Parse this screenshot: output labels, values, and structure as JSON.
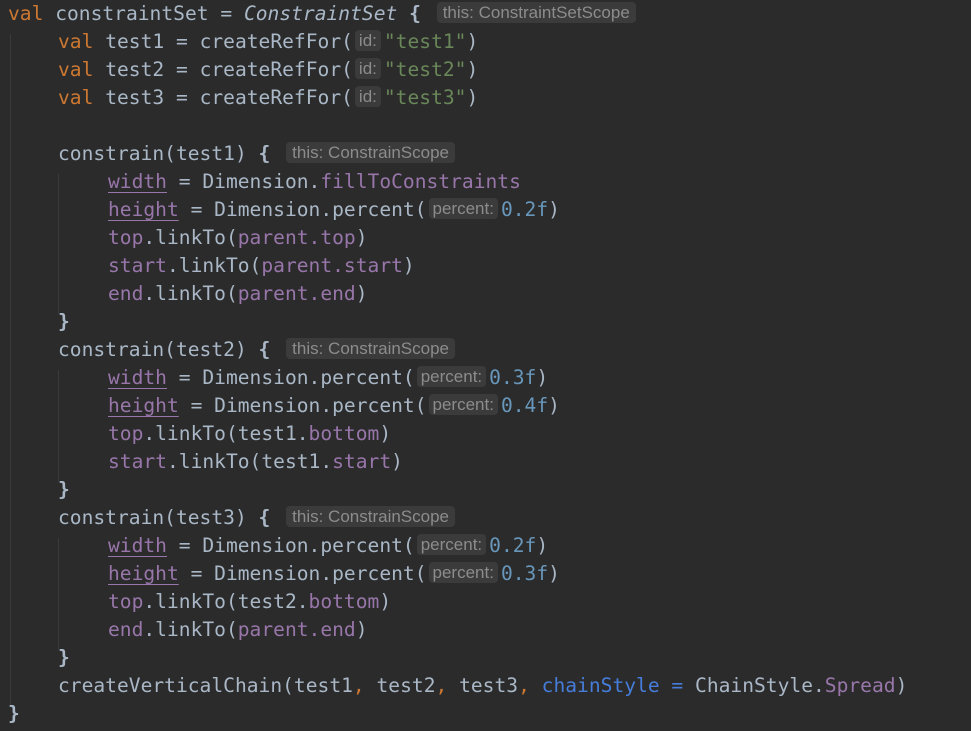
{
  "colors": {
    "background": "#2b2b2b",
    "keyword": "#cc7832",
    "string": "#6a8759",
    "number": "#6897bb",
    "property": "#9876aa",
    "named_arg": "#467cda",
    "text": "#a9b7c6",
    "hint_text": "#8c8c8c",
    "hint_bg": "#3b3b3b"
  },
  "code": {
    "kw_val": "val",
    "constraint_set_name": "constraintSet",
    "eq": "=",
    "constraint_set_type": "ConstraintSet",
    "open_brace": "{",
    "close_brace": "}",
    "hint_constraint_set_scope": "this: ConstraintSetScope",
    "refs": [
      {
        "name": "test1",
        "call": "createRefFor(",
        "hint": "id:",
        "arg": "\"test1\"",
        "close": ")"
      },
      {
        "name": "test2",
        "call": "createRefFor(",
        "hint": "id:",
        "arg": "\"test2\"",
        "close": ")"
      },
      {
        "name": "test3",
        "call": "createRefFor(",
        "hint": "id:",
        "arg": "\"test3\"",
        "close": ")"
      }
    ],
    "hint_constrain_scope": "this: ConstrainScope",
    "blocks": [
      {
        "header": "constrain(test1)",
        "width_prop": "width",
        "width_value": "Dimension.",
        "width_member": "fillToConstraints",
        "height_prop": "height",
        "height_call": "Dimension.percent(",
        "height_hint": "percent:",
        "height_arg": "0.2f",
        "links": [
          {
            "target": "top",
            "call": ".linkTo(",
            "obj": "",
            "member": "parent.top",
            "close": ")"
          },
          {
            "target": "start",
            "call": ".linkTo(",
            "obj": "",
            "member": "parent.start",
            "close": ")"
          },
          {
            "target": "end",
            "call": ".linkTo(",
            "obj": "",
            "member": "parent.end",
            "close": ")"
          }
        ]
      },
      {
        "header": "constrain(test2)",
        "width_prop": "width",
        "width_call": "Dimension.percent(",
        "width_hint": "percent:",
        "width_arg": "0.3f",
        "height_prop": "height",
        "height_call": "Dimension.percent(",
        "height_hint": "percent:",
        "height_arg": "0.4f",
        "links": [
          {
            "target": "top",
            "call": ".linkTo(",
            "obj": "test1.",
            "member": "bottom",
            "close": ")"
          },
          {
            "target": "start",
            "call": ".linkTo(",
            "obj": "test1.",
            "member": "start",
            "close": ")"
          }
        ]
      },
      {
        "header": "constrain(test3)",
        "width_prop": "width",
        "width_call": "Dimension.percent(",
        "width_hint": "percent:",
        "width_arg": "0.2f",
        "height_prop": "height",
        "height_call": "Dimension.percent(",
        "height_hint": "percent:",
        "height_arg": "0.3f",
        "links": [
          {
            "target": "top",
            "call": ".linkTo(",
            "obj": "test2.",
            "member": "bottom",
            "close": ")"
          },
          {
            "target": "end",
            "call": ".linkTo(",
            "obj": "",
            "member": "parent.end",
            "close": ")"
          }
        ]
      }
    ],
    "chain": {
      "call": "createVerticalChain(test1",
      "comma1": ",",
      "arg2": " test2",
      "comma2": ",",
      "arg3": " test3",
      "comma3": ",",
      "named": "chainStyle",
      "eq": " = ",
      "type": "ChainStyle.",
      "member": "Spread",
      "close": ")"
    }
  }
}
